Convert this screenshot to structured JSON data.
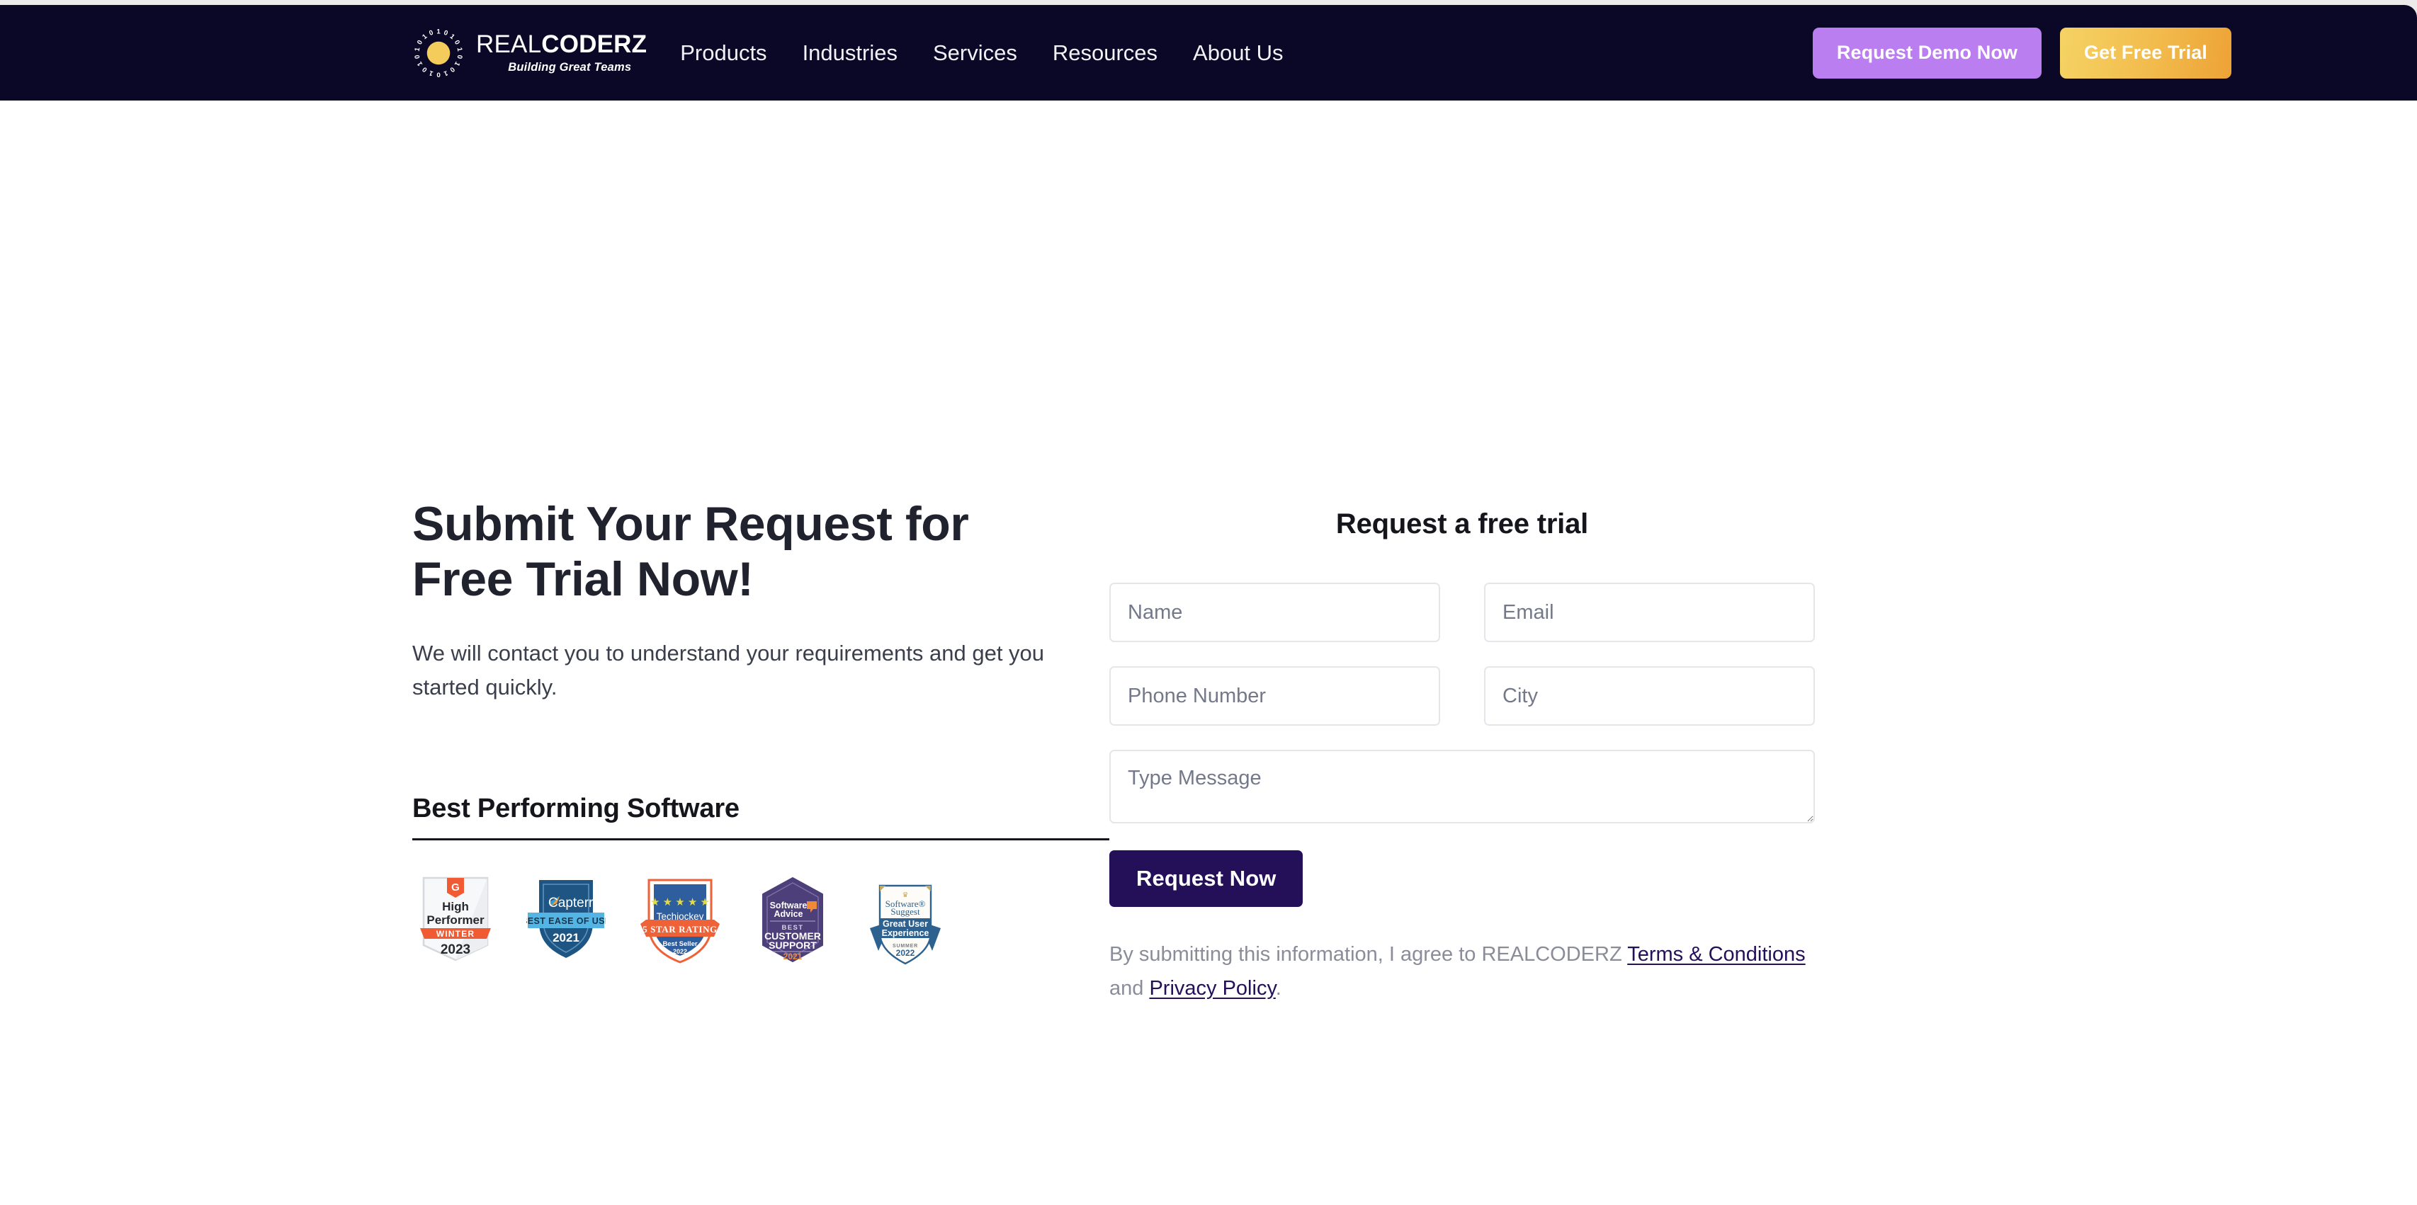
{
  "theme": {
    "header_bg": "#0a0826",
    "logo_yellow": "#f3cc5c",
    "demo_button_bg": "#ba7ef0",
    "trial_button_gradient_from": "#f5d364",
    "trial_button_gradient_to": "#eda236",
    "submit_button_bg": "#231058",
    "heading_color": "#20222e",
    "body_text_color": "#3b3f4c",
    "muted_text_color": "#8a8d99",
    "input_border": "#e4e6e9",
    "page_bg": "#ffffff"
  },
  "header": {
    "logo": {
      "icon": "binary-sun-logo-icon",
      "name_light": "REAL",
      "name_bold": "CODERZ",
      "tagline": "Building Great Teams"
    },
    "nav": [
      {
        "label": "Products"
      },
      {
        "label": "Industries"
      },
      {
        "label": "Services"
      },
      {
        "label": "Resources"
      },
      {
        "label": "About Us"
      }
    ],
    "actions": {
      "demo_label": "Request Demo Now",
      "trial_label": "Get Free Trial"
    }
  },
  "hero": {
    "title": "Submit Your Request for Free Trial Now!",
    "subtitle": "We will contact you to understand your requirements and get you started quickly.",
    "awards": {
      "title": "Best Performing Software",
      "badges": [
        {
          "name": "g2-high-performer-badge",
          "brand": "G2",
          "line1": "High",
          "line2": "Performer",
          "ribbon": "WINTER",
          "year": "2023"
        },
        {
          "name": "capterra-best-ease-of-use-badge",
          "brand": "Capterra",
          "ribbon": "BEST EASE OF USE",
          "year": "2021"
        },
        {
          "name": "techjockey-5-star-rating-badge",
          "brand": "Techjockey",
          "ribbon": "5 STAR RATING",
          "line1": "Best Seller",
          "year": "2022"
        },
        {
          "name": "software-advice-best-customer-support-badge",
          "brand": "Software Advice",
          "label": "BEST",
          "line1": "CUSTOMER",
          "line2": "SUPPORT",
          "year": "2021"
        },
        {
          "name": "softwaresuggest-great-user-experience-badge",
          "brand": "SoftwareSuggest",
          "line1": "Great User",
          "line2": "Experience",
          "label": "SUMMER",
          "year": "2022"
        }
      ]
    }
  },
  "form": {
    "heading": "Request a free trial",
    "fields": {
      "name": {
        "placeholder": "Name",
        "value": ""
      },
      "email": {
        "placeholder": "Email",
        "value": ""
      },
      "phone": {
        "placeholder": "Phone Number",
        "value": ""
      },
      "city": {
        "placeholder": "City",
        "value": ""
      },
      "message": {
        "placeholder": "Type Message",
        "value": ""
      }
    },
    "submit_label": "Request Now",
    "terms": {
      "prefix": "By submitting this information, I agree to REALCODERZ ",
      "terms_link": "Terms & Conditions",
      "middle": " and ",
      "privacy_link": "Privacy Policy",
      "suffix": "."
    }
  }
}
